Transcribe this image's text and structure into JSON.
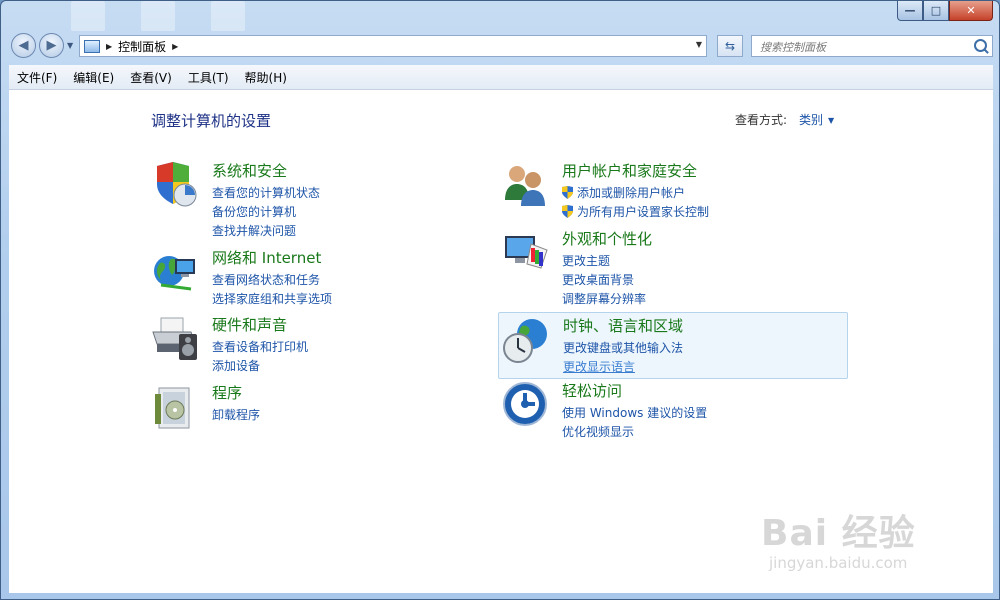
{
  "window": {
    "caption": {
      "minimize": "—",
      "maximize": "□",
      "close": "✕"
    }
  },
  "nav": {
    "back": "◀",
    "forward": "▶",
    "address": "控制面板",
    "search_placeholder": "搜索控制面板"
  },
  "menu": [
    "文件(F)",
    "编辑(E)",
    "查看(V)",
    "工具(T)",
    "帮助(H)"
  ],
  "main": {
    "title": "调整计算机的设置",
    "view_by_label": "查看方式:",
    "view_by_value": "类别"
  },
  "categories": [
    {
      "id": "system-security",
      "icon": "shield-icon",
      "title": "系统和安全",
      "links": [
        "查看您的计算机状态",
        "备份您的计算机",
        "查找并解决问题"
      ]
    },
    {
      "id": "network-internet",
      "icon": "globe-network-icon",
      "title": "网络和 Internet",
      "links": [
        "查看网络状态和任务",
        "选择家庭组和共享选项"
      ]
    },
    {
      "id": "hardware-sound",
      "icon": "printer-icon",
      "title": "硬件和声音",
      "links": [
        "查看设备和打印机",
        "添加设备"
      ]
    },
    {
      "id": "programs",
      "icon": "programs-icon",
      "title": "程序",
      "links": [
        "卸载程序"
      ]
    },
    {
      "id": "user-accounts",
      "icon": "users-icon",
      "title": "用户帐户和家庭安全",
      "links": [
        "添加或删除用户帐户",
        "为所有用户设置家长控制"
      ]
    },
    {
      "id": "appearance",
      "icon": "monitor-palette-icon",
      "title": "外观和个性化",
      "links": [
        "更改主题",
        "更改桌面背景",
        "调整屏幕分辨率"
      ]
    },
    {
      "id": "clock-language",
      "icon": "clock-globe-icon",
      "title": "时钟、语言和区域",
      "links": [
        "更改键盘或其他输入法",
        "更改显示语言"
      ]
    },
    {
      "id": "ease-of-access",
      "icon": "ease-of-access-icon",
      "title": "轻松访问",
      "links": [
        "使用 Windows 建议的设置",
        "优化视频显示"
      ]
    }
  ],
  "watermark": {
    "brand": "Bai 经验",
    "url": "jingyan.baidu.com"
  }
}
